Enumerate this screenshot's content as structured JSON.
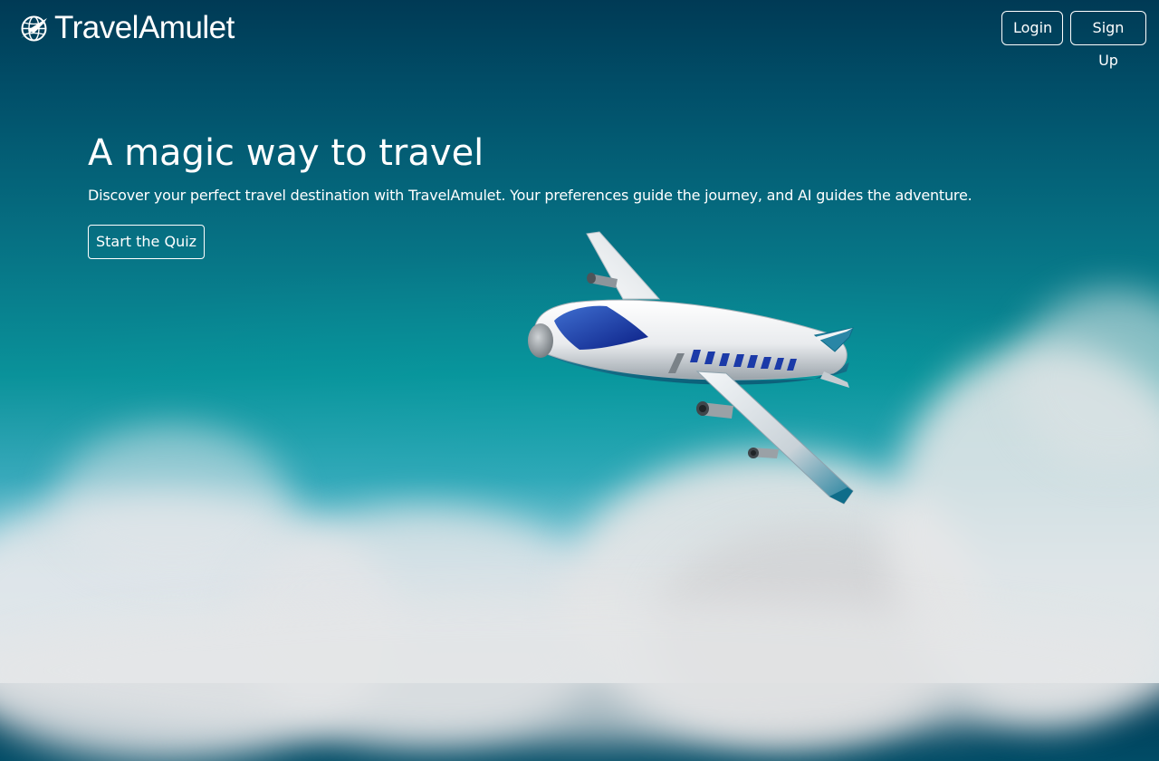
{
  "brand": {
    "name": "TravelAmulet",
    "logo_icon": "globe-plane-icon"
  },
  "nav": {
    "login_label": "Login",
    "signup_label": "Sign Up"
  },
  "hero": {
    "title": "A magic way to travel",
    "subtitle": "Discover your perfect travel destination with TravelAmulet. Your preferences guide the journey, and AI guides the adventure.",
    "cta_label": "Start the Quiz"
  },
  "background": {
    "illustration": "airplane-icon",
    "sky_top": "#003a55",
    "sky_mid": "#0a929a",
    "cloud_color": "#e4e6e7"
  }
}
